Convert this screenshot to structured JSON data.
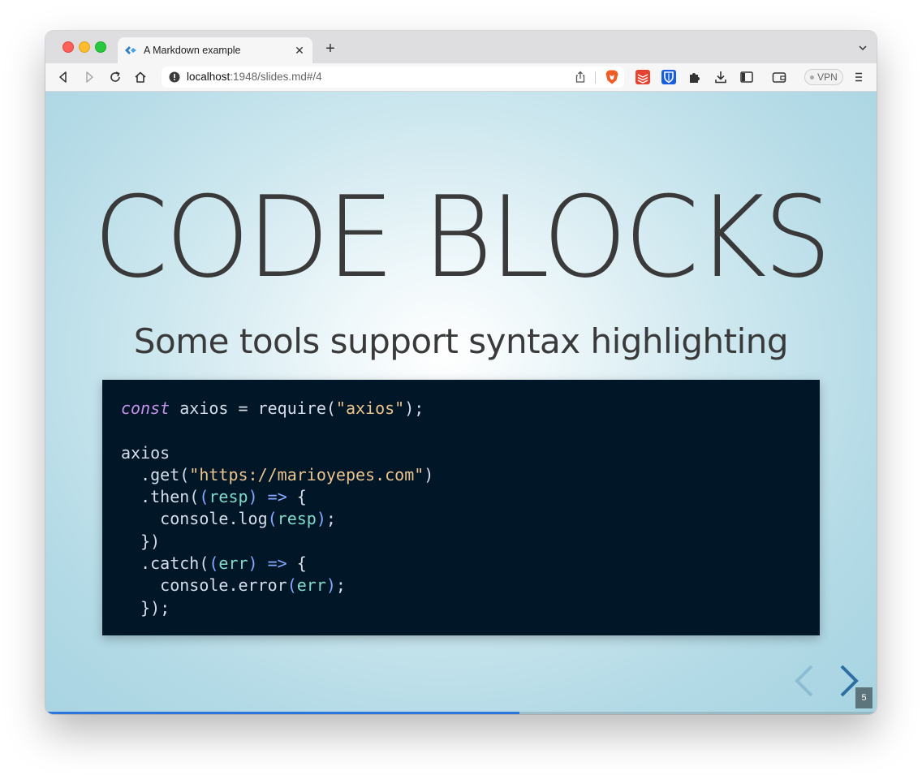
{
  "browser": {
    "tab": {
      "title": "A Markdown example"
    },
    "url": {
      "host": "localhost",
      "rest": ":1948/slides.md#/4"
    },
    "vpn_label": "VPN"
  },
  "slide": {
    "title": "CODE BLOCKS",
    "subtitle": "Some tools support syntax highlighting",
    "code_lines": [
      "const axios = require(\"axios\");",
      "",
      "axios",
      "  .get(\"https://marioyepes.com\")",
      "  .then((resp) => {",
      "    console.log(resp);",
      "  })",
      "  .catch((err) => {",
      "    console.error(err);",
      "  });"
    ],
    "slide_number": "5",
    "progress_fraction": 0.57
  },
  "colors": {
    "code_bg": "#011627",
    "keyword": "#c792ea",
    "function": "#c5e478",
    "string": "#ecc48d",
    "param": "#7fdbca",
    "punctuation_accent": "#82aaff",
    "progress": "#2a76dd",
    "nav_arrow": "#2d6ea3"
  },
  "icons": {
    "tab_favicon": "reveal-logo-icon",
    "toolbar": [
      "back-icon",
      "forward-icon",
      "reload-icon",
      "home-icon",
      "site-info-icon",
      "share-icon",
      "brave-shields-icon",
      "todoist-extension-icon",
      "bitwarden-extension-icon",
      "extensions-puzzle-icon",
      "downloads-icon",
      "sidebar-icon",
      "wallet-icon",
      "menu-icon"
    ]
  }
}
